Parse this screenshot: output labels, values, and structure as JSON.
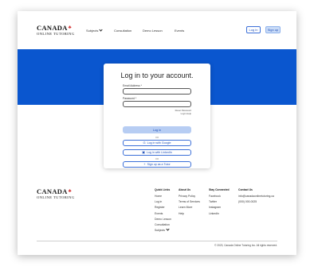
{
  "brand": {
    "name": "CANADA",
    "subtitle": "ONLINE TUTORING"
  },
  "nav": {
    "items": [
      "Subjects",
      "Consultation",
      "Demo Lesson",
      "Events"
    ],
    "login_label": "Log in",
    "signup_label": "Sign up"
  },
  "login": {
    "title": "Log in to your account.",
    "email_label": "Email Address *",
    "password_label": "Password *",
    "reset_link": "Reset Password",
    "login_help": "Login Help",
    "submit_label": "Log in",
    "or1": "OR",
    "google_label": "Log in with Google",
    "linkedin_label": "Log in with LinkedIn",
    "or2": "OR",
    "tutor_label": "Sign up as a Tutor"
  },
  "footer": {
    "quick_links": {
      "heading": "Quick Links",
      "items": [
        "Home",
        "Log in",
        "Register",
        "Events",
        "Demo Lesson",
        "Consultation",
        "Subjects"
      ]
    },
    "about": {
      "heading": "About Us",
      "items": [
        "Privacy Policy",
        "Terms of Services",
        "Learn More",
        "Help"
      ]
    },
    "social": {
      "heading": "Stay Connected",
      "items": [
        "Facebook",
        "Twitter",
        "Instagram",
        "LinkedIn"
      ]
    },
    "contact": {
      "heading": "Contact Us",
      "items": [
        "info@canadaonlinetutoring.ca",
        "(000) 000-0025"
      ]
    },
    "copyright": "© 2023, Canada Online Tutoring Inc. All rights reserved."
  },
  "colors": {
    "primary": "#0a56cf",
    "accent_red": "#d32f2f",
    "soft_button": "#b7cdf3"
  },
  "icons": {
    "brand": "maple-leaf-icon",
    "google": "google-icon",
    "linkedin": "linkedin-icon",
    "tutor": "plus-icon"
  }
}
